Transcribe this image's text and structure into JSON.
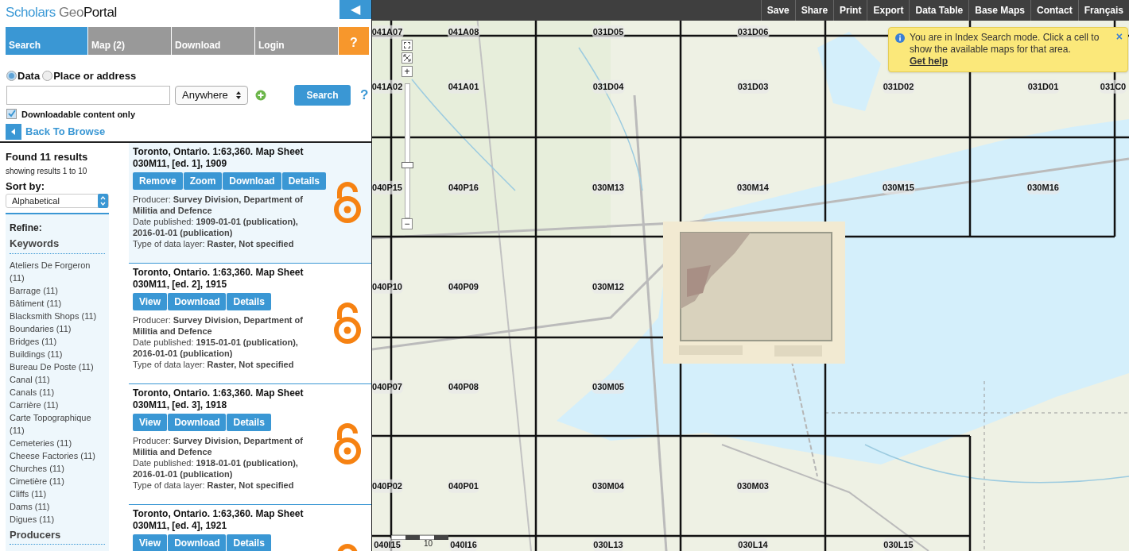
{
  "logo": {
    "part_1": "Scholars",
    "part_2": "Geo",
    "part_3": "Portal"
  },
  "collapse_button": "◀",
  "tabs": [
    {
      "label": "Search",
      "selected": true,
      "kind": "tab"
    },
    {
      "label": "Map (2)",
      "selected": false,
      "kind": "tab"
    },
    {
      "label": "Download",
      "selected": false,
      "kind": "tab"
    },
    {
      "label": "Login",
      "selected": false,
      "kind": "tab"
    },
    {
      "label": "?",
      "selected": false,
      "kind": "help"
    }
  ],
  "search": {
    "modes": [
      {
        "label": "Data",
        "selected": true
      },
      {
        "label": "Place or address",
        "selected": false
      }
    ],
    "extent": "Anywhere",
    "button": "Search",
    "help": "?",
    "downloadable_only": {
      "label": "Downloadable content only",
      "checked": true
    },
    "back": "Back To Browse"
  },
  "results_summary": {
    "found": "Found 11 results",
    "showing": "showing results 1 to 10",
    "sort_label": "Sort by:",
    "sort_value": "Alphabetical"
  },
  "refine": {
    "title": "Refine:",
    "sections": [
      {
        "heading": "Keywords",
        "items": [
          "Ateliers De Forgeron (11)",
          "Barrage (11)",
          "Bâtiment (11)",
          "Blacksmith Shops (11)",
          "Boundaries (11)",
          "Bridges (11)",
          "Buildings (11)",
          "Bureau De Poste (11)",
          "Canal (11)",
          "Canals (11)",
          "Carrière (11)",
          "Carte Topographique (11)",
          "Cemeteries (11)",
          "Cheese Factories (11)",
          "Churches (11)",
          "Cimetière (11)",
          "Cliffs (11)",
          "Dams (11)",
          "Digues (11)"
        ]
      },
      {
        "heading": "Producers"
      }
    ]
  },
  "results": [
    {
      "title": "Toronto, Ontario. 1:63,360. Map Sheet 030M11, [ed. 1], 1909",
      "selected": true,
      "buttons": [
        "Remove",
        "Zoom",
        "Download",
        "Details"
      ],
      "lines": [
        "Producer: **Survey Division, Department of Militia and Defence**",
        "Date published: **1909-01-01 (publication), 2016-01-01 (publication)**",
        "Type of data layer: **Raster, Not specified**"
      ]
    },
    {
      "title": "Toronto, Ontario. 1:63,360. Map Sheet 030M11, [ed. 2], 1915",
      "selected": false,
      "buttons": [
        "View",
        "Download",
        "Details"
      ],
      "lines": [
        "Producer: **Survey Division, Department of Militia and Defence**",
        "Date published: **1915-01-01 (publication), 2016-01-01 (publication)**",
        "Type of data layer: **Raster, Not specified**"
      ]
    },
    {
      "title": "Toronto, Ontario. 1:63,360. Map Sheet 030M11, [ed. 3], 1918",
      "selected": false,
      "buttons": [
        "View",
        "Download",
        "Details"
      ],
      "lines": [
        "Producer: **Survey Division, Department of Militia and Defence**",
        "Date published: **1918-01-01 (publication), 2016-01-01 (publication)**",
        "Type of data layer: **Raster, Not specified**"
      ]
    },
    {
      "title": "Toronto, Ontario. 1:63,360. Map Sheet 030M11, [ed. 4], 1921",
      "selected": false,
      "buttons": [
        "View",
        "Download",
        "Details"
      ]
    }
  ],
  "toolbar": [
    "Save",
    "Share",
    "Print",
    "Export",
    "Data Table",
    "Base Maps",
    "Contact",
    "Français"
  ],
  "notice": {
    "text": "You are in Index Search mode. Click a cell to show the available maps for that area.",
    "link": "Get help",
    "close": "×"
  },
  "zoom": {
    "plus": "+",
    "minus": "−",
    "level": 0.42
  },
  "scale_bar": {
    "label": "10"
  },
  "grid_rows": [
    [
      "041A07",
      "041A08",
      "031D05",
      "031D06"
    ],
    [
      "041A02",
      "041A01",
      "031D04",
      "031D03",
      "031D02",
      "031D01",
      "031C0"
    ],
    [
      "040P15",
      "040P16",
      "030M13",
      "030M14",
      "030M15",
      "030M16"
    ],
    [
      "040P10",
      "040P09",
      "030M12"
    ],
    [
      "040P07",
      "040P08",
      "030M05"
    ],
    [
      "040P02",
      "040P01",
      "030M04",
      "030M03"
    ],
    [
      "040I15",
      "040I16",
      "030L13",
      "030L14",
      "030L15"
    ]
  ]
}
